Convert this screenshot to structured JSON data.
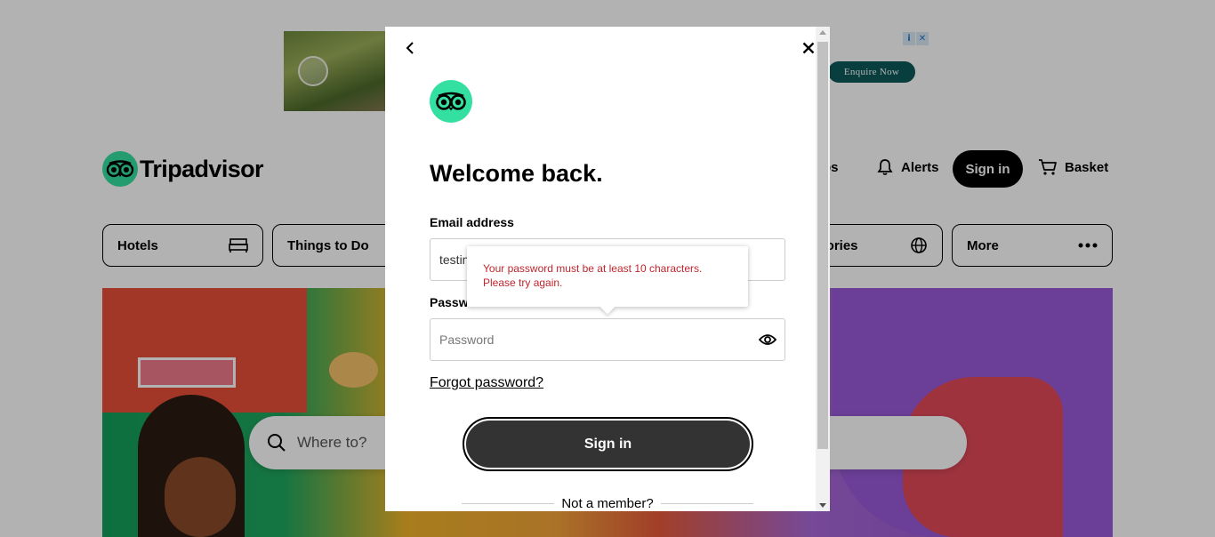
{
  "ad": {
    "cta_label": "Enquire Now",
    "choices_info": "i",
    "choices_close": "✕"
  },
  "header": {
    "logo_text": "Tripadvisor",
    "trips_label": "rips",
    "alerts_label": "Alerts",
    "signin_label": "Sign in",
    "basket_label": "Basket"
  },
  "categories": {
    "hotels": "Hotels",
    "things_to_do": "Things to Do",
    "travel_stories": "el Stories",
    "more": "More"
  },
  "hero": {
    "search_placeholder": "Where to?"
  },
  "modal": {
    "title": "Welcome back.",
    "email_label": "Email address",
    "email_value": "testin",
    "password_label": "Passwo",
    "password_placeholder": "Password",
    "tooltip_line1": "Your password must be at least 10 characters.",
    "tooltip_line2": "Please try again.",
    "forgot_label": "Forgot password?",
    "signin_label": "Sign in",
    "not_member_label": "Not a member?"
  },
  "colors": {
    "brand_green": "#34e0a1",
    "error_red": "#c0262d",
    "button_dark": "#333333"
  },
  "icons": [
    "back-arrow-icon",
    "close-icon",
    "owl-logo-icon",
    "eye-icon",
    "bell-icon",
    "cart-icon",
    "bed-icon",
    "globe-icon",
    "more-dots-icon",
    "search-icon"
  ]
}
